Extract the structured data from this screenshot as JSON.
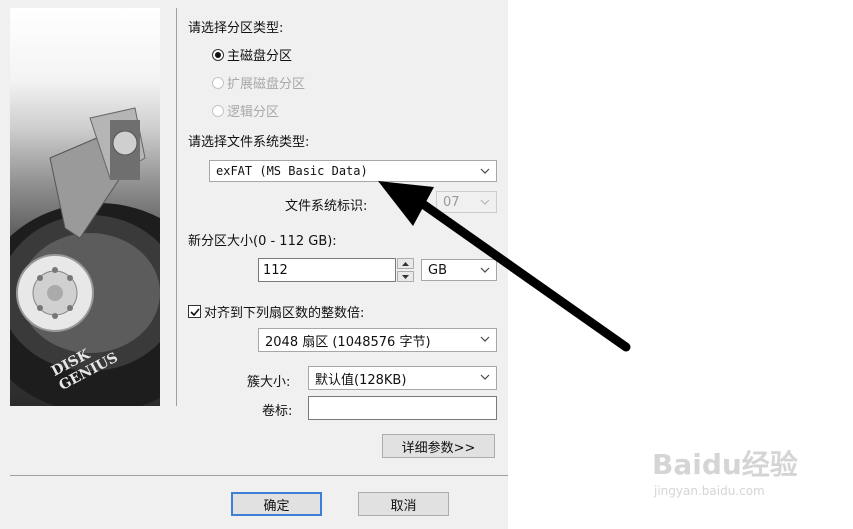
{
  "partition_type": {
    "label": "请选择分区类型:",
    "options": [
      {
        "label": "主磁盘分区",
        "checked": true,
        "enabled": true
      },
      {
        "label": "扩展磁盘分区",
        "checked": false,
        "enabled": false
      },
      {
        "label": "逻辑分区",
        "checked": false,
        "enabled": false
      }
    ]
  },
  "filesystem": {
    "label": "请选择文件系统类型:",
    "selected": "exFAT (MS Basic Data)",
    "id_label": "文件系统标识:",
    "id_value": "07"
  },
  "size": {
    "label": "新分区大小(0 - 112 GB):",
    "value": "112",
    "unit": "GB"
  },
  "align": {
    "label": "对齐到下列扇区数的整数倍:",
    "checked": true,
    "selected": "2048 扇区 (1048576 字节)"
  },
  "cluster": {
    "label": "簇大小:",
    "selected": "默认值(128KB)"
  },
  "volume": {
    "label": "卷标:",
    "value": ""
  },
  "buttons": {
    "advanced": "详细参数>>",
    "ok": "确定",
    "cancel": "取消"
  },
  "side_image": {
    "brand": "DISK GENIUS"
  },
  "watermark": {
    "logo": "Baidu经验",
    "url": "jingyan.baidu.com"
  },
  "colors": {
    "dialog_bg": "#f0f0f0",
    "default_button_border": "#3d7fd6",
    "arrow": "#000000"
  }
}
